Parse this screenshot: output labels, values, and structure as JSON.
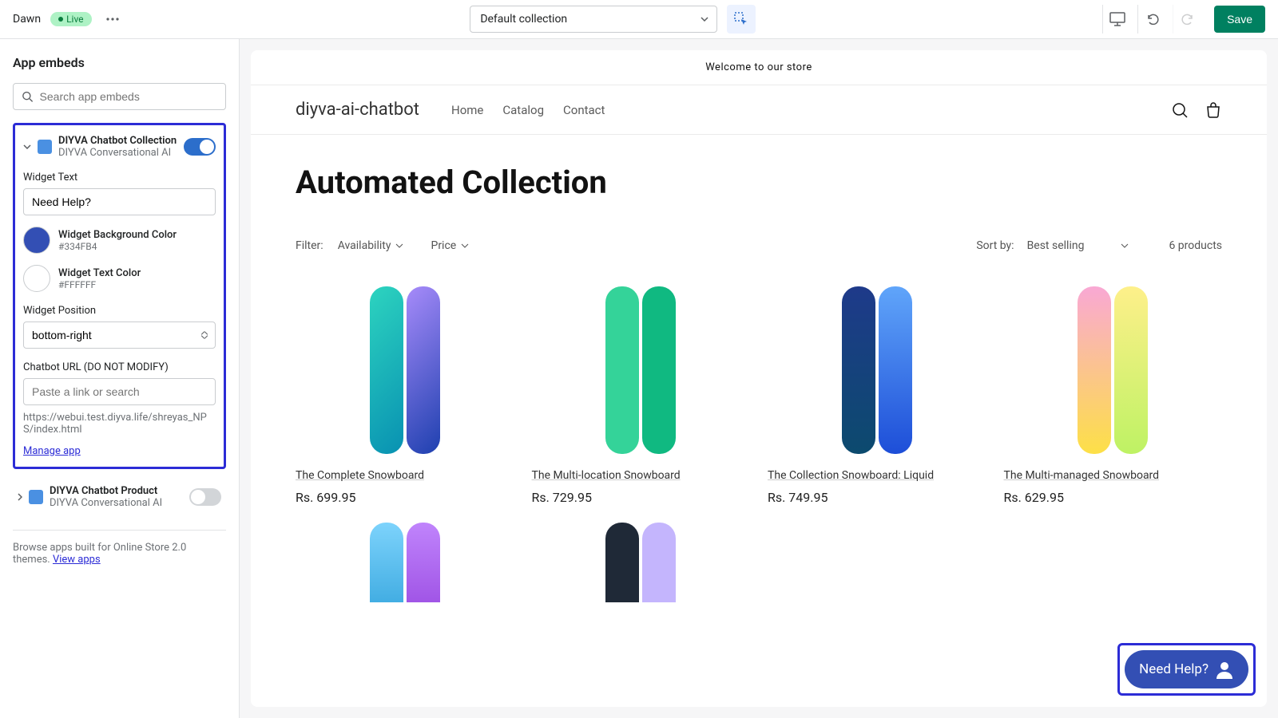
{
  "topbar": {
    "theme_name": "Dawn",
    "live_label": "Live",
    "template_selected": "Default collection",
    "save_label": "Save"
  },
  "sidebar": {
    "title": "App embeds",
    "search_placeholder": "Search app embeds",
    "embed1": {
      "name": "DIYVA Chatbot Collection",
      "subtitle": "DIYVA Conversational AI",
      "widget_text_label": "Widget Text",
      "widget_text_value": "Need Help?",
      "bg_color_label": "Widget Background Color",
      "bg_color_hex": "#334FB4",
      "text_color_label": "Widget Text Color",
      "text_color_hex": "#FFFFFF",
      "position_label": "Widget Position",
      "position_value": "bottom-right",
      "url_label": "Chatbot URL (DO NOT MODIFY)",
      "url_placeholder": "Paste a link or search",
      "url_value": "https://webui.test.diyva.life/shreyas_NPS/index.html",
      "manage_label": "Manage app"
    },
    "embed2": {
      "name": "DIYVA Chatbot Product",
      "subtitle": "DIYVA Conversational AI"
    },
    "browse_text": "Browse apps built for Online Store 2.0 themes. ",
    "browse_link": "View apps"
  },
  "store": {
    "announcement": "Welcome to our store",
    "logo": "diyva-ai-chatbot",
    "nav": {
      "home": "Home",
      "catalog": "Catalog",
      "contact": "Contact"
    },
    "collection_title": "Automated Collection",
    "filter_label": "Filter:",
    "filter_availability": "Availability",
    "filter_price": "Price",
    "sort_label": "Sort by:",
    "sort_value": "Best selling",
    "product_count": "6 products",
    "products": [
      {
        "name": "The Complete Snowboard",
        "price": "Rs. 699.95"
      },
      {
        "name": "The Multi-location Snowboard",
        "price": "Rs. 729.95"
      },
      {
        "name": "The Collection Snowboard: Liquid",
        "price": "Rs. 749.95"
      },
      {
        "name": "The Multi-managed Snowboard",
        "price": "Rs. 629.95"
      }
    ],
    "chat_widget_label": "Need Help?"
  }
}
